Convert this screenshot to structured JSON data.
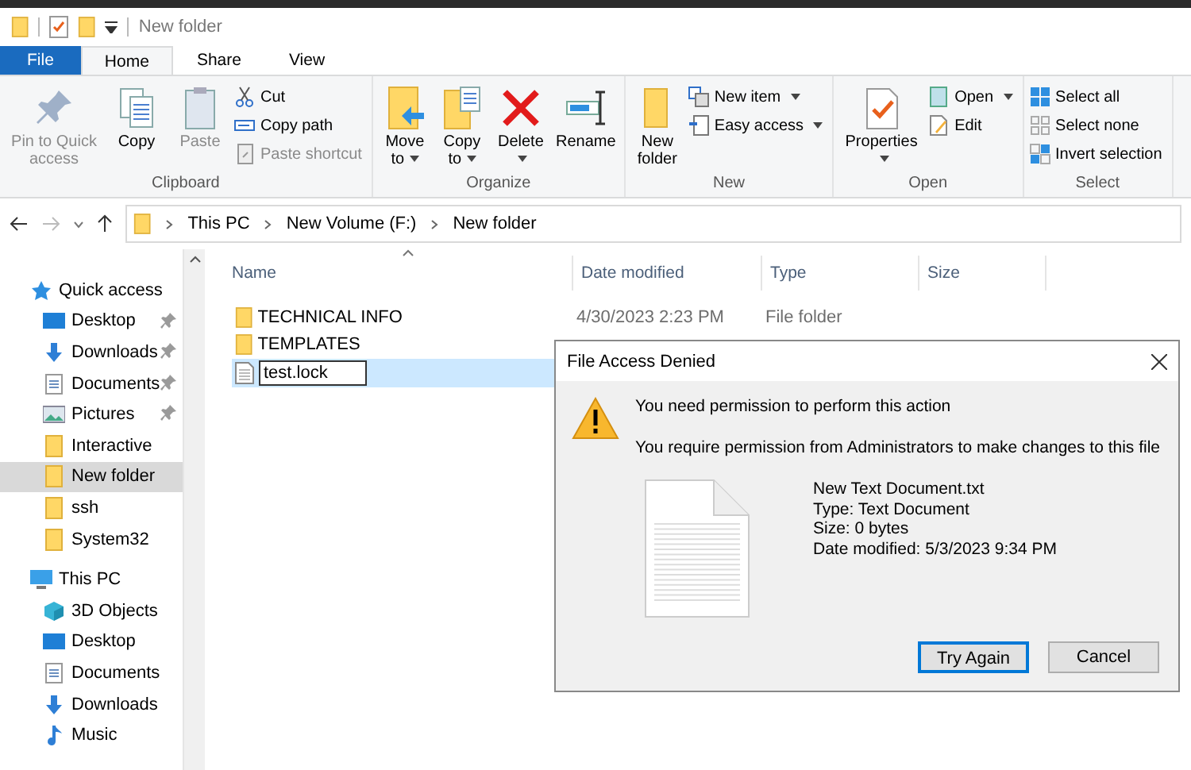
{
  "title_bar": {
    "title": "New folder"
  },
  "ribbon_tabs": [
    {
      "label": "File",
      "kind": "file",
      "selected": false
    },
    {
      "label": "Home",
      "kind": "tab",
      "selected": true
    },
    {
      "label": "Share",
      "kind": "tab",
      "selected": false
    },
    {
      "label": "View",
      "kind": "tab",
      "selected": false
    }
  ],
  "ribbon_groups": [
    {
      "label": "Clipboard",
      "commands": [
        {
          "label": "Pin to Quick access",
          "kind": "large",
          "disabled": true,
          "has_menu": false
        },
        {
          "label": "Copy",
          "kind": "large",
          "disabled": false,
          "has_menu": false
        },
        {
          "label": "Paste",
          "kind": "large",
          "disabled": true,
          "has_menu": false
        },
        {
          "label": "Cut",
          "kind": "small",
          "disabled": false,
          "has_menu": false
        },
        {
          "label": "Copy path",
          "kind": "small",
          "disabled": false,
          "has_menu": false
        },
        {
          "label": "Paste shortcut",
          "kind": "small",
          "disabled": true,
          "has_menu": false
        }
      ]
    },
    {
      "label": "Organize",
      "commands": [
        {
          "label": "Move to",
          "kind": "large",
          "disabled": false,
          "has_menu": true
        },
        {
          "label": "Copy to",
          "kind": "large",
          "disabled": false,
          "has_menu": true
        },
        {
          "label": "Delete",
          "kind": "large",
          "disabled": false,
          "has_menu": true
        },
        {
          "label": "Rename",
          "kind": "large",
          "disabled": false,
          "has_menu": false
        }
      ]
    },
    {
      "label": "New",
      "commands": [
        {
          "label": "New folder",
          "kind": "large",
          "disabled": false,
          "has_menu": false
        },
        {
          "label": "New item",
          "kind": "small",
          "disabled": false,
          "has_menu": true
        },
        {
          "label": "Easy access",
          "kind": "small",
          "disabled": false,
          "has_menu": true
        }
      ]
    },
    {
      "label": "Open",
      "commands": [
        {
          "label": "Properties",
          "kind": "large",
          "disabled": false,
          "has_menu": true
        },
        {
          "label": "Open",
          "kind": "small",
          "disabled": false,
          "has_menu": true
        },
        {
          "label": "Edit",
          "kind": "small",
          "disabled": false,
          "has_menu": false
        }
      ]
    },
    {
      "label": "Select",
      "commands": [
        {
          "label": "Select all",
          "kind": "small",
          "disabled": false,
          "has_menu": false
        },
        {
          "label": "Select none",
          "kind": "small",
          "disabled": false,
          "has_menu": false
        },
        {
          "label": "Invert selection",
          "kind": "small",
          "disabled": false,
          "has_menu": false
        }
      ]
    }
  ],
  "address_bar": {
    "crumbs": [
      "This PC",
      "New Volume (F:)",
      "New folder"
    ]
  },
  "navigation_pane": [
    {
      "label": "Quick access",
      "kind": "star",
      "selected": false,
      "children": [
        {
          "label": "Desktop",
          "kind": "desktop",
          "selected": false,
          "pinned": true
        },
        {
          "label": "Downloads",
          "kind": "download",
          "selected": false,
          "pinned": true
        },
        {
          "label": "Documents",
          "kind": "document",
          "selected": false,
          "pinned": true
        },
        {
          "label": "Pictures",
          "kind": "pictures",
          "selected": false,
          "pinned": true
        },
        {
          "label": "Interactive",
          "kind": "folder",
          "selected": false,
          "pinned": false
        },
        {
          "label": "New folder",
          "kind": "folder",
          "selected": true,
          "pinned": false
        },
        {
          "label": "ssh",
          "kind": "folder",
          "selected": false,
          "pinned": false
        },
        {
          "label": "System32",
          "kind": "folder",
          "selected": false,
          "pinned": false
        }
      ]
    },
    {
      "label": "This PC",
      "kind": "pc",
      "selected": false,
      "children": [
        {
          "label": "3D Objects",
          "kind": "cube",
          "selected": false,
          "pinned": false
        },
        {
          "label": "Desktop",
          "kind": "desktop",
          "selected": false,
          "pinned": false
        },
        {
          "label": "Documents",
          "kind": "document",
          "selected": false,
          "pinned": false
        },
        {
          "label": "Downloads",
          "kind": "download",
          "selected": false,
          "pinned": false
        },
        {
          "label": "Music",
          "kind": "music",
          "selected": false,
          "pinned": false
        }
      ]
    }
  ],
  "file_list": {
    "columns": [
      {
        "label": "Name",
        "sorted": true
      },
      {
        "label": "Date modified",
        "sorted": false
      },
      {
        "label": "Type",
        "sorted": false
      },
      {
        "label": "Size",
        "sorted": false
      }
    ],
    "rows": [
      {
        "name": "TECHNICAL INFO",
        "kind": "folder",
        "date_modified": "4/30/2023 2:23 PM",
        "type": "File folder",
        "selected": false,
        "editing": false
      },
      {
        "name": "TEMPLATES",
        "kind": "folder",
        "selected": false,
        "editing": false
      },
      {
        "name": "test.lock",
        "kind": "file",
        "selected": true,
        "editing": true
      }
    ]
  },
  "dialog": {
    "title": "File Access Denied",
    "heading": "You need permission to perform this action",
    "message": "You require permission from Administrators to make changes to this file",
    "file_details": [
      "New Text Document.txt",
      "Type: Text Document",
      "Size: 0 bytes",
      "Date modified: 5/3/2023 9:34 PM"
    ],
    "buttons": [
      {
        "label": "Try Again",
        "default": true
      },
      {
        "label": "Cancel",
        "default": false
      }
    ]
  }
}
